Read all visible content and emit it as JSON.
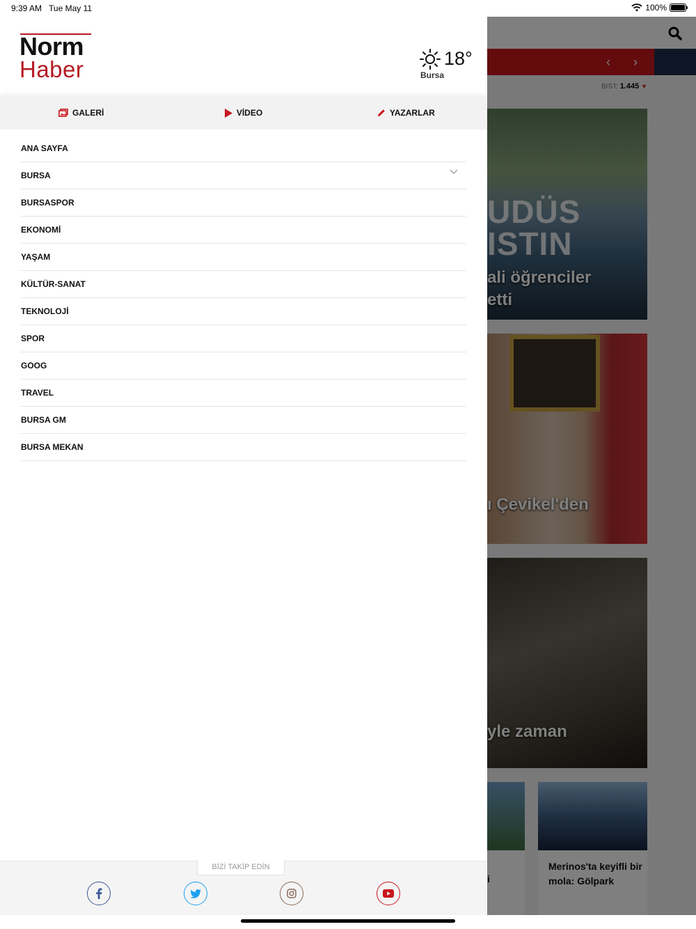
{
  "status_bar": {
    "time": "9:39 AM",
    "date": "Tue May 11",
    "battery": "100%"
  },
  "logo": {
    "line1": "Norm",
    "line2": "Haber"
  },
  "weather": {
    "temperature": "18°",
    "city": "Bursa",
    "icon": "sun-icon"
  },
  "tabs": [
    {
      "label": "GALERİ",
      "icon": "gallery-icon"
    },
    {
      "label": "VİDEO",
      "icon": "play-icon"
    },
    {
      "label": "YAZARLAR",
      "icon": "pencil-icon"
    }
  ],
  "menu": [
    "ANA SAYFA",
    "BURSA",
    "BURSASPOR",
    "EKONOMİ",
    "YAŞAM",
    "KÜLTÜR-SANAT",
    "TEKNOLOJİ",
    "SPOR",
    "GOOG",
    "TRAVEL",
    "BURSA GM",
    "BURSA MEKAN"
  ],
  "footer": {
    "follow_label": "BİZİ TAKİP EDİN",
    "social": [
      {
        "name": "facebook-icon",
        "color": "#3b5998"
      },
      {
        "name": "twitter-icon",
        "color": "#1da1f2"
      },
      {
        "name": "instagram-icon",
        "color": "#8a6a5a"
      },
      {
        "name": "youtube-icon",
        "color": "#c8161d"
      }
    ]
  },
  "background": {
    "bist_label": "BIST:",
    "bist_value": "1.445",
    "card1_big": "UDÜS\nISTIN",
    "card1_caption_1": "ali öğrenciler",
    "card1_caption_2": "etti",
    "card2_caption": "ı Çevikel'den",
    "card3_caption": "yle zaman",
    "small1_caption": "i",
    "small2_caption": "Merinos'ta keyifli bir mola: Gölpark"
  },
  "colors": {
    "brand_red": "#b51b23",
    "navy": "#1c2a4a"
  }
}
